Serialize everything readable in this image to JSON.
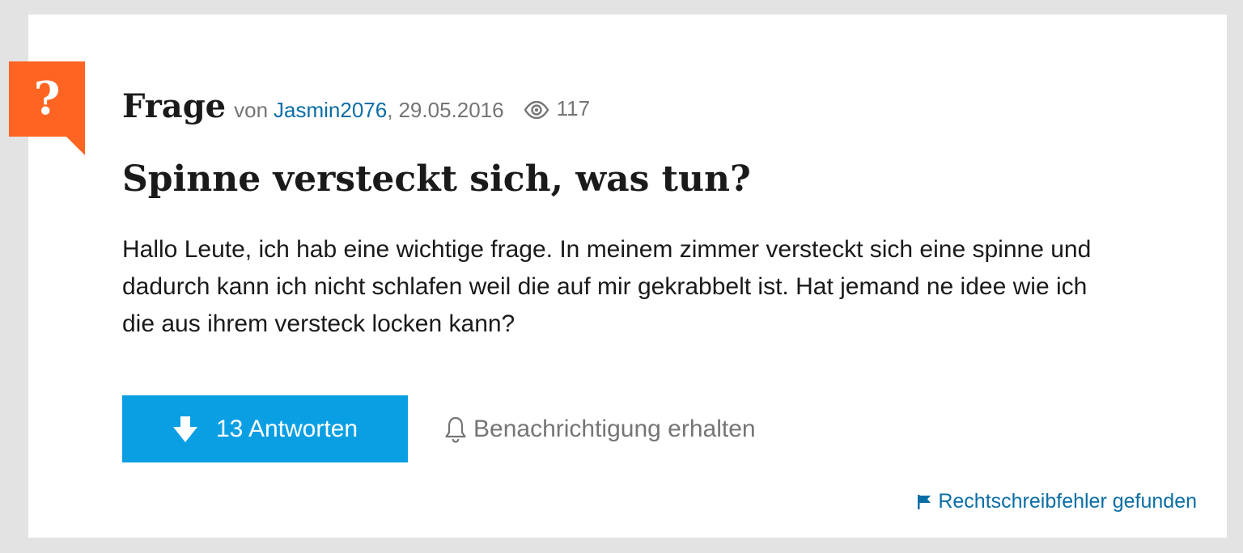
{
  "question": {
    "badge_mark": "?",
    "type_label": "Frage",
    "by_label": "von",
    "author": "Jasmin2076",
    "date_sep": ",",
    "date": "29.05.2016",
    "views": "117",
    "title": "Spinne versteckt sich, was tun?",
    "body": "Hallo Leute, ich hab eine wichtige frage. In meinem zimmer versteckt sich eine spinne und dadurch kann ich nicht schlafen weil die auf mir gekrabbelt ist. Hat jemand ne idee wie ich die aus ihrem versteck locken kann?"
  },
  "actions": {
    "answers_label": "13 Antworten",
    "notify_label": "Benachrichtigung erhalten",
    "report_label": "Rechtschreibfehler gefunden"
  },
  "icons": {
    "badge": "question-mark-icon",
    "views": "eye-icon",
    "answers": "arrow-down-icon",
    "notify": "bell-icon",
    "report": "flag-icon"
  },
  "colors": {
    "accent_orange": "#ff6422",
    "button_blue": "#0a9fe3",
    "link_blue": "#0b6ea6",
    "muted_gray": "#757575",
    "page_background": "#e3e3e3"
  }
}
